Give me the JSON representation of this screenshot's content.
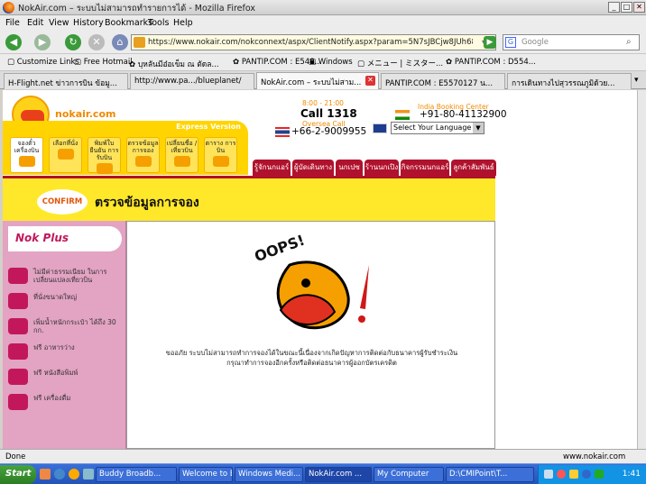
{
  "window": {
    "title": "NokAir.com – ระบบไม่สามารถทำรายการได้ - Mozilla Firefox",
    "min": "_",
    "max": "□",
    "close": "✕"
  },
  "menu": [
    "File",
    "Edit",
    "View",
    "History",
    "Bookmarks",
    "Tools",
    "Help"
  ],
  "toolbar": {
    "url": "https://www.nokair.com/nokconnext/aspx/ClientNotify.aspx?param=5N7sJBCjw8JUh687fMrr1qu92D'",
    "search_placeholder": "Google"
  },
  "bookmarks": [
    "Customize Links",
    "Free Hotmail",
    "บุหลันมีอ๋อเข็ม ณ ตัดล...",
    "PANTIP.COM : E548...",
    "Windows",
    "メニュー | ミスター...",
    "PANTIP.COM : D554..."
  ],
  "tabs": [
    {
      "label": "H-Flight.net ข่าวการบิน ข้อมู...",
      "active": false
    },
    {
      "label": "http://www.pa.../blueplanet/",
      "active": false
    },
    {
      "label": "NokAir.com – ระบบไม่สาม...",
      "active": true
    },
    {
      "label": "PANTIP.COM : E5570127 น...",
      "active": false
    },
    {
      "label": "การเดินทางไปสุวรรณภูมิด้วย...",
      "active": false
    }
  ],
  "site": {
    "logo_text": "nokair.com",
    "express_label": "Express Version",
    "quick_buttons": [
      "จองตั๋ว เครื่องบิน",
      "เลือกที่นั่ง",
      "พิมพ์ใบยืนยัน การรับบิน",
      "ตรวจข้อมูล การจอง",
      "เปลี่ยนชื่อ /เที่ยวบิน",
      "ตาราง การบิน"
    ],
    "hours": "8:00 - 21:00",
    "call": "Call 1318",
    "oversea": "Oversea Call",
    "oversea_phone": "+66-2-9009955",
    "india_label": "India Booking Center",
    "india_phone": "+91-80-41132900",
    "language": "Select Your Language",
    "nav_tabs": [
      "รู้จักนกแอร์",
      "ผู้บัดเดินทาง",
      "นกเปซ",
      "ร้านนกเปิง",
      "กิจกรรมนกแอร์",
      "ลูกค้าสัมพันธ์"
    ],
    "confirm_badge": "CONFIRM",
    "confirm_title": "ตรวจข้อมูลการจอง",
    "nokplus_title": "Nok Plus",
    "nokplus_items": [
      "ไม่มีค่าธรรมเนียม ในการเปลี่ยนแปลงเที่ยวบิน",
      "ที่นั่งขนาดใหญ่",
      "เพิ่มน้ำหนักกระเป๋า ได้ถึง 30 กก.",
      "ฟรี อาหารว่าง",
      "ฟรี หนังสือพิมพ์",
      "ฟรี เครื่องดื่ม"
    ],
    "oops": "OOPS!",
    "message_line1": "ขออภัย ระบบไม่สามารถทำการจองได้ในขณะนี้เนื่องจากเกิดปัญหาการติดต่อกับธนาคารผู้รับชำระเงิน",
    "message_line2": "กรุณาทำการจองอีกครั้งหรือติดต่อธนาคารผู้ออกบัตรเครดิต"
  },
  "status": {
    "left": "Done",
    "right": "www.nokair.com"
  },
  "taskbar": {
    "start": "Start",
    "items": [
      {
        "label": "Buddy Broadb...",
        "active": false
      },
      {
        "label": "Welcome to B...",
        "active": false
      },
      {
        "label": "Windows Medi...",
        "active": false
      },
      {
        "label": "NokAir.com ...",
        "active": true
      },
      {
        "label": "My Computer",
        "active": false
      },
      {
        "label": "D:\\CMIPoint\\T...",
        "active": false
      }
    ],
    "clock": "1:41"
  }
}
